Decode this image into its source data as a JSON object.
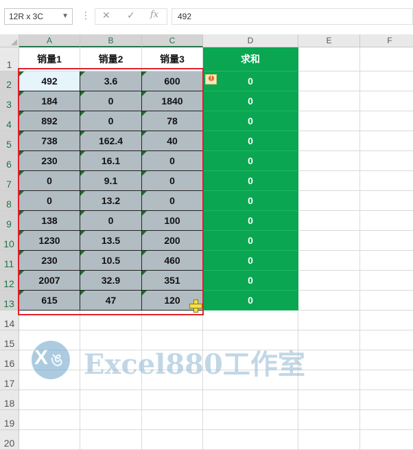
{
  "name_box": "12R x 3C",
  "formula_icons": {
    "more": "⋮",
    "cancel": "✕",
    "enter": "✓",
    "fx": "fx"
  },
  "formula_value": "492",
  "columns": [
    "A",
    "B",
    "C",
    "D",
    "E",
    "F"
  ],
  "rows": [
    "1",
    "2",
    "3",
    "4",
    "5",
    "6",
    "7",
    "8",
    "9",
    "10",
    "11",
    "12",
    "13",
    "14",
    "15",
    "16",
    "17",
    "18",
    "19",
    "20"
  ],
  "headers": {
    "A": "销量1",
    "B": "销量2",
    "C": "销量3",
    "D": "求和"
  },
  "data": [
    [
      "492",
      "3.6",
      "600"
    ],
    [
      "184",
      "0",
      "1840"
    ],
    [
      "892",
      "0",
      "78"
    ],
    [
      "738",
      "162.4",
      "40"
    ],
    [
      "230",
      "16.1",
      "0"
    ],
    [
      "0",
      "9.1",
      "0"
    ],
    [
      "0",
      "13.2",
      "0"
    ],
    [
      "138",
      "0",
      "100"
    ],
    [
      "1230",
      "13.5",
      "200"
    ],
    [
      "230",
      "10.5",
      "460"
    ],
    [
      "2007",
      "32.9",
      "351"
    ],
    [
      "615",
      "47",
      "120"
    ]
  ],
  "sums": [
    "0",
    "0",
    "0",
    "0",
    "0",
    "0",
    "0",
    "0",
    "0",
    "0",
    "0",
    "0"
  ],
  "colors": {
    "sum_bg": "#0aa651",
    "data_bg": "#b2bcc3",
    "selection": "#e0202a",
    "active": "#e6f4fc"
  },
  "icons": {
    "warning": "error-warning-icon",
    "fill": "fill-handle-cursor-icon"
  },
  "watermark": {
    "logo_x": "X",
    "logo_t": "ঙ",
    "text": "Excel880工作室"
  }
}
